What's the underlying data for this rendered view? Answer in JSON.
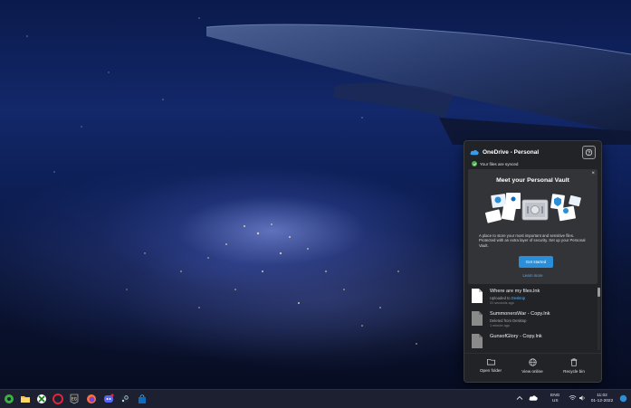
{
  "colors": {
    "accent": "#2a8ed8",
    "synced": "#4caf50",
    "flyout_bg": "#222327",
    "taskbar_bg": "#1c2030"
  },
  "onedrive": {
    "title": "OneDrive - Personal",
    "help_icon": "help-settings-icon",
    "sync_status": "Your files are synced",
    "vault": {
      "title": "Meet your Personal Vault",
      "description": "A place to store your most important and sensitive files. Protected with an extra layer of security. Set up your Personal Vault.",
      "primary_button": "Get started",
      "link": "Learn more",
      "close_glyph": "×"
    },
    "files": [
      {
        "name": "Where are my files.lnk",
        "status_prefix": "Uploaded to ",
        "location": "Desktop",
        "time": "31 seconds ago",
        "icon": "document-icon"
      },
      {
        "name": "SummonersWar - Copy.lnk",
        "status_prefix": "Deleted from ",
        "location": "Desktop",
        "time": "1 minute ago",
        "icon": "document-icon"
      },
      {
        "name": "GunsofGlory - Copy.lnk",
        "status_prefix": "",
        "location": "",
        "time": "",
        "icon": "document-icon"
      }
    ],
    "footer": [
      {
        "label": "Open folder",
        "icon": "folder-icon"
      },
      {
        "label": "View online",
        "icon": "globe-icon"
      },
      {
        "label": "Recycle bin",
        "icon": "recycle-bin-icon"
      }
    ]
  },
  "taskbar": {
    "language": "ENG",
    "region": "US",
    "time": "11:02",
    "date": "01-12-2022",
    "apps": [
      "weather-widget-icon",
      "file-explorer-icon",
      "xbox-icon",
      "opera-icon",
      "epic-games-icon",
      "firefox-icon",
      "discord-icon",
      "steam-icon",
      "store-icon"
    ]
  }
}
